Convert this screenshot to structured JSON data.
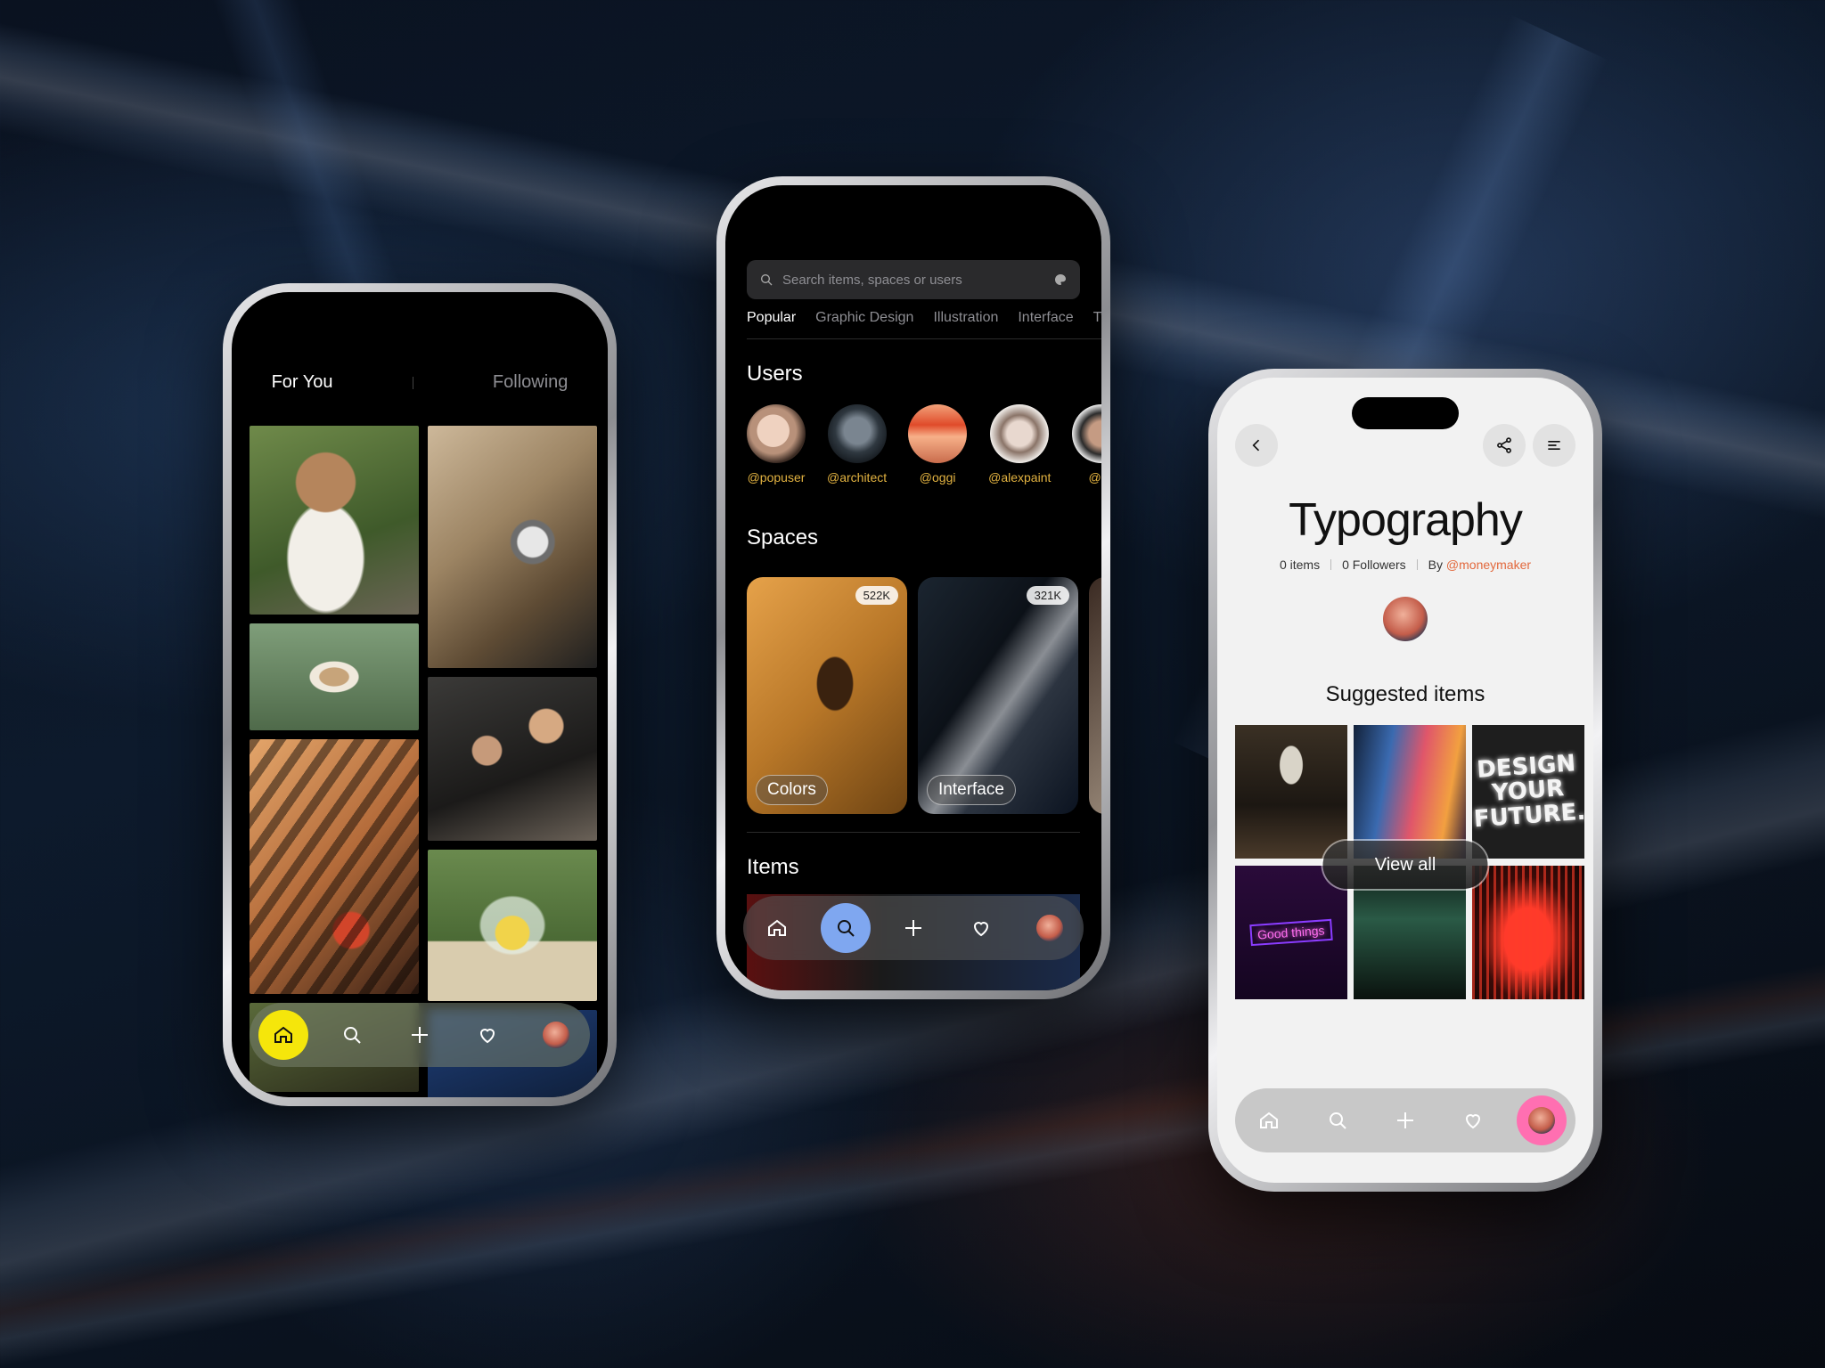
{
  "left_phone": {
    "tabs": {
      "active": "For You",
      "inactive": "Following"
    },
    "nav_icons": [
      "home-icon",
      "search-icon",
      "plus-icon",
      "heart-icon",
      "avatar"
    ],
    "active_color": "#f5e60b"
  },
  "middle_phone": {
    "search": {
      "placeholder": "Search items, spaces or users"
    },
    "categories": [
      "Popular",
      "Graphic Design",
      "Illustration",
      "Interface",
      "Ty"
    ],
    "users_title": "Users",
    "users": [
      "@popuser",
      "@architect",
      "@oggi",
      "@alexpaint",
      "@rol"
    ],
    "spaces_title": "Spaces",
    "spaces": [
      {
        "label": "Colors",
        "count": "522K"
      },
      {
        "label": "Interface",
        "count": "321K"
      }
    ],
    "items_title": "Items",
    "handle_color": "#e3b341",
    "active_color": "#7fa7f0"
  },
  "right_phone": {
    "title": "Typography",
    "items_count": "0 items",
    "followers": "0 Followers",
    "by_prefix": "By",
    "by_user": "@moneymaker",
    "suggested_title": "Suggested items",
    "view_all": "View all",
    "poster_text": "DESIGN YOUR FUTURE.",
    "neon_text": "Good things",
    "accent_color": "#e2683c",
    "active_color": "#ff6fb1"
  }
}
